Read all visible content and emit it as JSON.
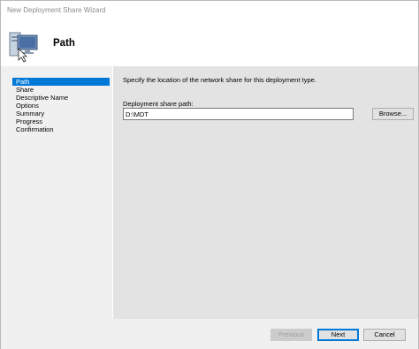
{
  "window": {
    "title": "New Deployment Share Wizard"
  },
  "header": {
    "title": "Path",
    "icon": "computer-share-icon"
  },
  "nav": {
    "items": [
      {
        "label": "Path",
        "selected": true
      },
      {
        "label": "Share"
      },
      {
        "label": "Descriptive Name"
      },
      {
        "label": "Options"
      },
      {
        "label": "Summary"
      },
      {
        "label": "Progress"
      },
      {
        "label": "Confirmation"
      }
    ]
  },
  "panel": {
    "instruction": "Specify the location of the network share for this deployment type.",
    "path_label": "Deployment share path:",
    "path_value": "D:\\MDT",
    "browse_label": "Browse..."
  },
  "footer": {
    "previous_label": "Previous",
    "next_label": "Next",
    "cancel_label": "Cancel"
  },
  "colors": {
    "selection": "#0078d7",
    "panel": "#e3e3e3",
    "background": "#f0f0f0"
  }
}
